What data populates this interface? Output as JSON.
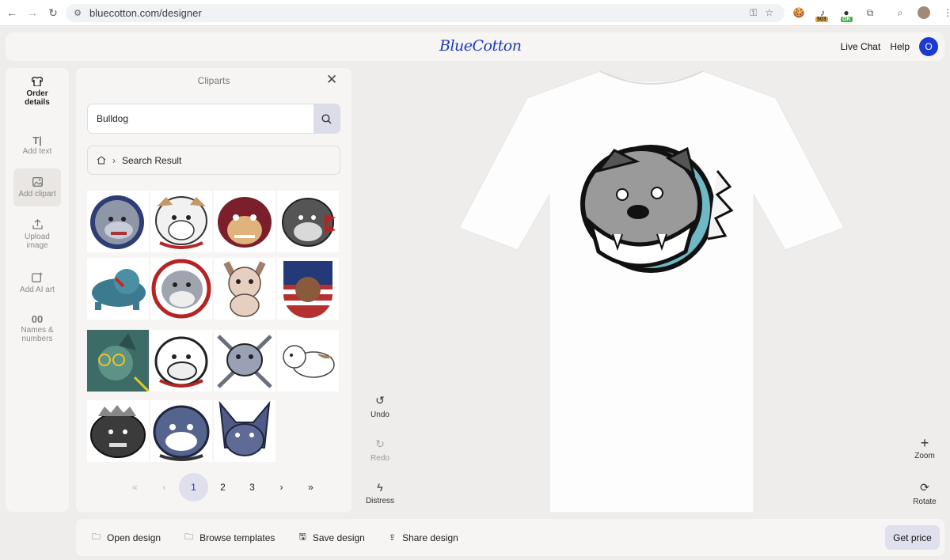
{
  "browser": {
    "url": "bluecotton.com/designer",
    "ext_503": "503",
    "ext_ok": "OK"
  },
  "header": {
    "logo": "BlueCotton",
    "live_chat": "Live Chat",
    "help": "Help",
    "user_initial": "O"
  },
  "tools": [
    {
      "label": "Order details",
      "icon": "shirt-icon"
    },
    {
      "label": "Add text",
      "icon": "text-icon"
    },
    {
      "label": "Add clipart",
      "icon": "image-icon"
    },
    {
      "label": "Upload image",
      "icon": "upload-icon"
    },
    {
      "label": "Add AI art",
      "icon": "ai-art-icon"
    },
    {
      "label": "Names & numbers",
      "icon": "numbers-icon"
    }
  ],
  "clipart_panel": {
    "title": "Cliparts",
    "search_value": "Bulldog",
    "breadcrumb": "Search Result",
    "pagination": {
      "first": "«",
      "prev": "‹",
      "pages": [
        "1",
        "2",
        "3"
      ],
      "current": "1",
      "next": "›",
      "last": "»"
    }
  },
  "canvas_tools": {
    "undo": "Undo",
    "redo": "Redo",
    "distress": "Distress",
    "zoom": "Zoom",
    "rotate": "Rotate"
  },
  "bottom_bar": {
    "open_design": "Open design",
    "browse_templates": "Browse templates",
    "save_design": "Save design",
    "share_design": "Share design",
    "get_price": "Get price"
  }
}
